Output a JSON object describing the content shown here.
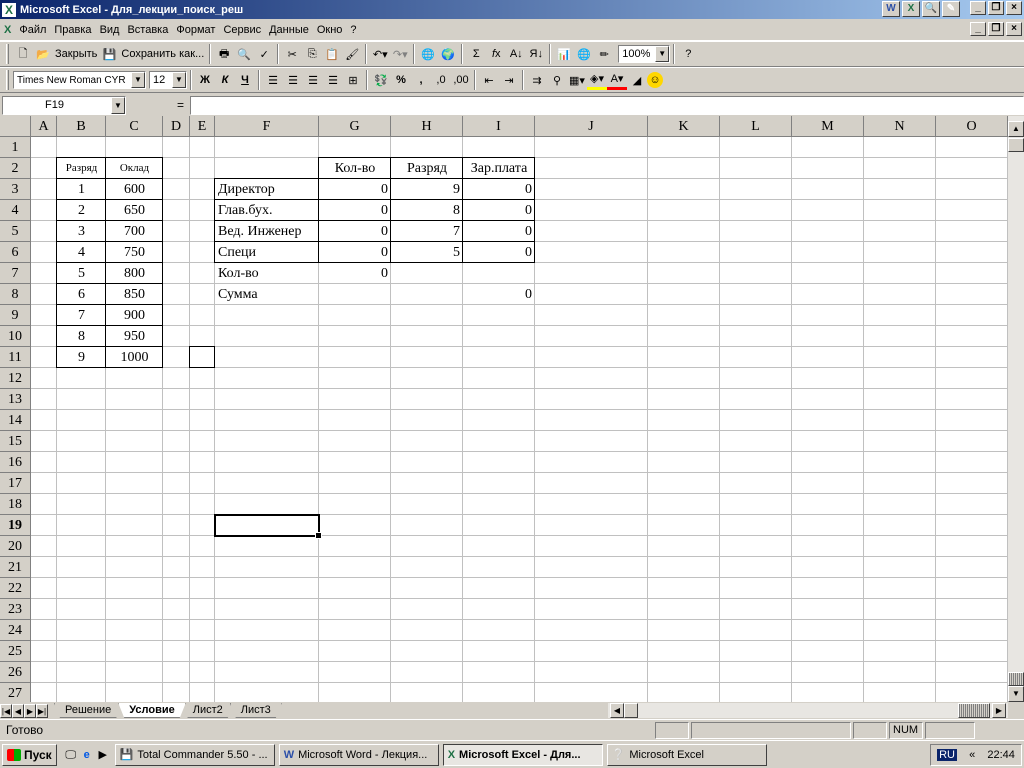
{
  "window": {
    "title": "Microsoft Excel - Для_лекции_поиск_реш",
    "app_icon": "excel-icon",
    "quick_icons": [
      "word-icon",
      "excel-icon",
      "finder-icon",
      "notepad-icon"
    ]
  },
  "menu": [
    "Файл",
    "Правка",
    "Вид",
    "Вставка",
    "Формат",
    "Сервис",
    "Данные",
    "Окно",
    "?"
  ],
  "toolbar": {
    "close_label": "Закрыть",
    "save_as_label": "Сохранить как...",
    "zoom": "100%"
  },
  "format": {
    "font": "Times New Roman CYR",
    "size": "12",
    "bold": "Ж",
    "italic": "К",
    "underline": "Ч",
    "percent": "%",
    "comma": ","
  },
  "formula_bar": {
    "name_box": "F19",
    "equals": "=",
    "value": ""
  },
  "columns": [
    "A",
    "B",
    "C",
    "D",
    "E",
    "F",
    "G",
    "H",
    "I",
    "J",
    "K",
    "L",
    "M",
    "N",
    "O"
  ],
  "rows": [
    "1",
    "2",
    "3",
    "4",
    "5",
    "6",
    "7",
    "8",
    "9",
    "10",
    "11",
    "12",
    "13",
    "14",
    "15",
    "16",
    "17",
    "18",
    "19",
    "20",
    "21",
    "22",
    "23",
    "24",
    "25",
    "26",
    "27"
  ],
  "salary_table": {
    "headers": [
      "Разряд",
      "Оклад"
    ],
    "rows": [
      [
        "1",
        "600"
      ],
      [
        "2",
        "650"
      ],
      [
        "3",
        "700"
      ],
      [
        "4",
        "750"
      ],
      [
        "5",
        "800"
      ],
      [
        "6",
        "850"
      ],
      [
        "7",
        "900"
      ],
      [
        "8",
        "950"
      ],
      [
        "9",
        "1000"
      ]
    ]
  },
  "staff_table": {
    "headers": [
      "Кол-во",
      "Разряд",
      "Зар.плата"
    ],
    "rows": [
      {
        "name": "Директор",
        "qty": "0",
        "grade": "9",
        "pay": "0"
      },
      {
        "name": "Глав.бух.",
        "qty": "0",
        "grade": "8",
        "pay": "0"
      },
      {
        "name": "Вед. Инженер",
        "qty": "0",
        "grade": "7",
        "pay": "0"
      },
      {
        "name": "Специ",
        "qty": "0",
        "grade": "5",
        "pay": "0"
      }
    ],
    "total_qty_label": "Кол-во",
    "total_qty": "0",
    "sum_label": "Сумма",
    "sum": "0"
  },
  "sheets": [
    "Решение",
    "Условие",
    "Лист2",
    "Лист3"
  ],
  "active_sheet": "Условие",
  "status": {
    "text": "Готово",
    "num": "NUM"
  },
  "taskbar": {
    "start": "Пуск",
    "tasks": [
      "Total Commander 5.50 - ...",
      "Microsoft Word - Лекция...",
      "Microsoft Excel - Для...",
      "Microsoft Excel"
    ],
    "lang": "RU",
    "clock": "22:44"
  }
}
